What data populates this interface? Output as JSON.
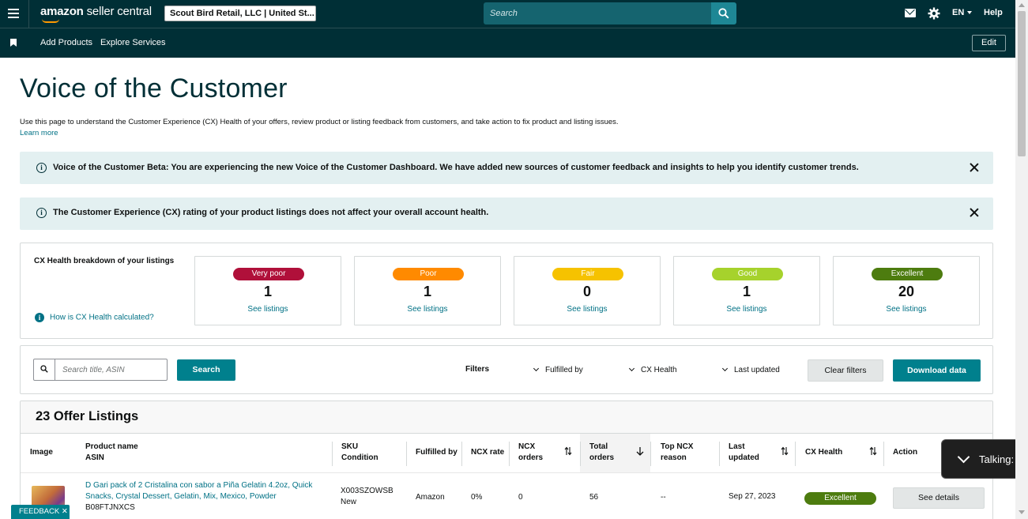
{
  "topnav": {
    "logo_brand": "amazon",
    "logo_rest": " seller central",
    "account": "Scout Bird Retail, LLC | United St...",
    "search_placeholder": "Search",
    "language": "EN",
    "help": "Help"
  },
  "subnav": {
    "links": [
      "Add Products",
      "Explore Services"
    ],
    "edit": "Edit"
  },
  "page": {
    "title": "Voice of the Customer",
    "description": "Use this page to understand the Customer Experience (CX) Health of your offers, review product or listing feedback from customers, and take action to fix product and listing issues.",
    "learn_more": "Learn more"
  },
  "alerts": [
    {
      "message": "Voice of the Customer Beta: You are experiencing the new Voice of the Customer Dashboard. We have added new sources of customer feedback and insights to help you identify customer trends."
    },
    {
      "message": "The Customer Experience (CX) rating of your product listings does not affect your overall account health."
    }
  ],
  "breakdown": {
    "title": "CX Health breakdown of your listings",
    "how_calculated": "How is CX Health calculated?",
    "cards": [
      {
        "label": "Very poor",
        "count": "1",
        "link": "See listings",
        "color": "#b0103a"
      },
      {
        "label": "Poor",
        "count": "1",
        "link": "See listings",
        "color": "#ff8a00"
      },
      {
        "label": "Fair",
        "count": "0",
        "link": "See listings",
        "color": "#f6c200"
      },
      {
        "label": "Good",
        "count": "1",
        "link": "See listings",
        "color": "#a6d22c"
      },
      {
        "label": "Excellent",
        "count": "20",
        "link": "See listings",
        "color": "#4d7c0f"
      }
    ]
  },
  "search_panel": {
    "placeholder": "Search title, ASIN",
    "search_button": "Search",
    "filters_label": "Filters",
    "filters": [
      "Fulfilled by",
      "CX Health",
      "Last updated"
    ],
    "clear_filters": "Clear filters",
    "download": "Download data"
  },
  "listings": {
    "title": "23 Offer Listings",
    "columns": {
      "image": "Image",
      "product_name": "Product name",
      "asin": "ASIN",
      "sku": "SKU",
      "condition": "Condition",
      "fulfilled_by": "Fulfilled by",
      "ncx_rate": "NCX rate",
      "ncx_orders_1": "NCX",
      "ncx_orders_2": "orders",
      "total_orders_1": "Total",
      "total_orders_2": "orders",
      "top_ncx_1": "Top NCX",
      "top_ncx_2": "reason",
      "last_updated_1": "Last",
      "last_updated_2": "updated",
      "cx_health": "CX Health",
      "action": "Action"
    },
    "rows": [
      {
        "product_name": "D Gari pack of 2 Cristalina con sabor a Piña Gelatin 4.2oz, Quick Snacks, Crystal Dessert, Gelatin, Mix, Mexico, Powder",
        "asin": "B08FTJNXCS",
        "sku": "X003SZOWSB",
        "condition": "New",
        "fulfilled_by": "Amazon",
        "ncx_rate": "0%",
        "ncx_orders": "0",
        "total_orders": "56",
        "top_ncx_reason": "--",
        "last_updated": "Sep 27, 2023",
        "cx_health": "Excellent",
        "cx_color": "#4d7c0f",
        "action": "See details"
      }
    ]
  },
  "feedback_tab": "FEEDBACK ✕",
  "toast": "Talking: Ale"
}
